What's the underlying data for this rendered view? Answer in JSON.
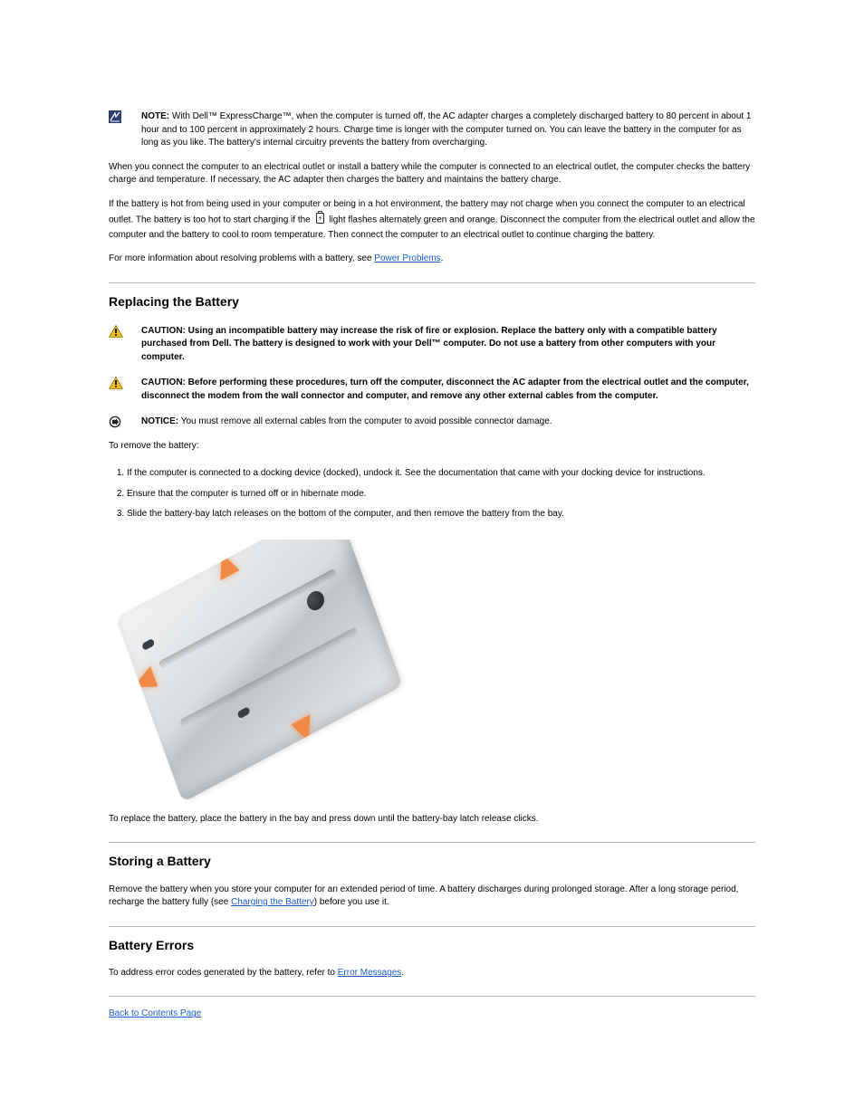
{
  "note1": {
    "prefix": "NOTE:",
    "text_a": "With Dell™ ExpressCharge™, when the computer is turned off, the AC adapter charges a completely discharged battery to 80 percent in about 1 hour and to 100 percent in approximately 2 hours. Charge time is longer with the computer turned on. You can leave the battery in the computer for as long as you like. The battery's internal circuitry prevents the battery from overcharging."
  },
  "para_ac1": "When you connect the computer to an electrical outlet or install a battery while the computer is connected to an electrical outlet, the computer checks the battery charge and temperature. If necessary, the AC adapter then charges the battery and maintains the battery charge.",
  "para_ac2_a": "If the battery is hot from being used in your computer or being in a hot environment, the battery may not charge when you connect the computer to an electrical outlet. The battery is too hot to start charging if the ",
  "para_ac2_b_icon": "battery-charge-indicator",
  "para_ac2_c": " light flashes alternately green and orange. Disconnect the computer from the electrical outlet and allow the computer and the battery to cool to room temperature. Then connect the computer to an electrical outlet to continue charging the battery.",
  "para_ac3_a": "For more information about resolving problems with a battery, see ",
  "para_ac3_link": "Power Problems",
  "para_ac3_b": ".",
  "replace": {
    "title": "Replacing the Battery",
    "caution1_prefix": "CAUTION:",
    "caution1": "Using an incompatible battery may increase the risk of fire or explosion. Replace the battery only with a compatible battery purchased from Dell. The battery is designed to work with your Dell™ computer. Do not use a battery from other computers with your computer.",
    "caution2_prefix": "CAUTION:",
    "caution2_a": "Before performing these procedures, turn off the computer, disconnect the AC adapter from the electrical outlet and the computer, disconnect the modem from the wall connector and computer, and remove any other external cables from the computer.",
    "notice_prefix": "NOTICE:",
    "notice": "You must remove all external cables from the computer to avoid possible connector damage.",
    "lead": "To remove the battery:",
    "steps": [
      "If the computer is connected to a docking device (docked), undock it. See the documentation that came with your docking device for instructions.",
      "Ensure that the computer is turned off or in hibernate mode.",
      "Slide the battery-bay latch releases on the bottom of the computer, and then remove the battery from the bay."
    ],
    "tail": "To replace the battery, place the battery in the bay and press down until the battery-bay latch release clicks."
  },
  "store": {
    "title": "Storing a Battery",
    "body_a": "Remove the battery when you store your computer for an extended period of time. A battery discharges during prolonged storage. After a long storage period, recharge the battery fully (see ",
    "body_link": "Charging the Battery",
    "body_b": ") before you use it."
  },
  "errors": {
    "title": "Battery Errors",
    "body_a": "To address error codes generated by the battery, refer to ",
    "body_link": "Error Messages",
    "body_b": "."
  },
  "footer_link": "Back to Contents Page"
}
